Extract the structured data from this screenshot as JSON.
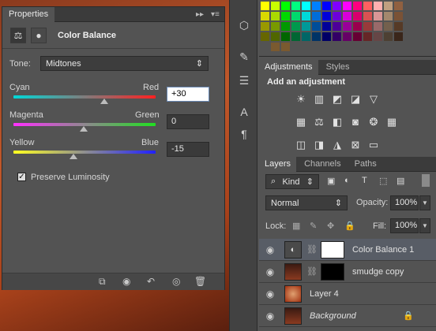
{
  "properties": {
    "tab_label": "Properties",
    "collapse_glyph": "▸▸",
    "menu_glyph": "▾≡",
    "panel_title": "Color Balance",
    "tone_label": "Tone:",
    "tone_value": "Midtones",
    "cyan_label": "Cyan",
    "red_label": "Red",
    "cyan_red_value": "+30",
    "magenta_label": "Magenta",
    "green_label": "Green",
    "magenta_green_value": "0",
    "yellow_label": "Yellow",
    "blue_label": "Blue",
    "yellow_blue_value": "-15",
    "preserve_label": "Preserve Luminosity",
    "preserve_checked": true
  },
  "adjustments": {
    "tab_adjustments": "Adjustments",
    "tab_styles": "Styles",
    "heading": "Add an adjustment",
    "icons_row1": [
      "brightness-contrast-icon",
      "levels-icon",
      "curves-icon",
      "exposure-icon",
      "vibrance-icon"
    ],
    "icons_row2": [
      "hue-saturation-icon",
      "color-balance-icon",
      "black-white-icon",
      "photo-filter-icon",
      "channel-mixer-icon",
      "color-lookup-icon"
    ],
    "icons_row3": [
      "invert-icon",
      "posterize-icon",
      "threshold-icon",
      "selective-color-icon",
      "gradient-map-icon"
    ]
  },
  "layers": {
    "tab_layers": "Layers",
    "tab_channels": "Channels",
    "tab_paths": "Paths",
    "filter_value": "Kind",
    "blend_mode": "Normal",
    "opacity_label": "Opacity:",
    "opacity_value": "100%",
    "lock_label": "Lock:",
    "fill_label": "Fill:",
    "fill_value": "100%",
    "rows": [
      {
        "name": "Color Balance 1"
      },
      {
        "name": "smudge copy"
      },
      {
        "name": "Layer 4"
      },
      {
        "name": "Background"
      }
    ]
  }
}
